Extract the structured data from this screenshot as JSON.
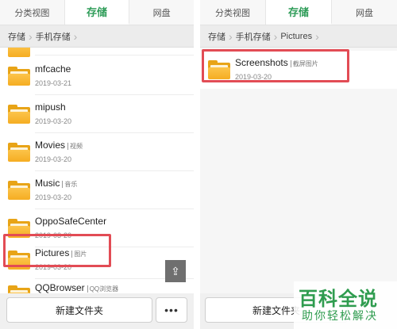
{
  "tabs": {
    "categories": "分类视图",
    "storage": "存储",
    "cloud": "网盘"
  },
  "left": {
    "breadcrumb": [
      "存储",
      "手机存储"
    ],
    "partial_date": "2019-03-21",
    "items": [
      {
        "name": "mfcache",
        "tag": "",
        "date": "2019-03-21"
      },
      {
        "name": "mipush",
        "tag": "",
        "date": "2019-03-20"
      },
      {
        "name": "Movies",
        "tag": "视频",
        "date": "2019-03-20"
      },
      {
        "name": "Music",
        "tag": "音乐",
        "date": "2019-03-20"
      },
      {
        "name": "OppoSafeCenter",
        "tag": "",
        "date": "2019-03-20"
      },
      {
        "name": "Pictures",
        "tag": "图片",
        "date": "2019-03-20"
      },
      {
        "name": "QQBrowser",
        "tag": "QQ浏览器",
        "date": ""
      }
    ],
    "scroll_top_icon": "scroll-top-icon",
    "new_folder_label": "新建文件夹",
    "more_label": "•••"
  },
  "right": {
    "breadcrumb": [
      "存储",
      "手机存储",
      "Pictures"
    ],
    "items": [
      {
        "name": "Screenshots",
        "tag": "截屏图片",
        "date": "2019-03-20"
      }
    ],
    "new_folder_label": "新建文件夹"
  },
  "watermark": {
    "title": "百科全说",
    "subtitle": "助你轻松解决"
  },
  "colors": {
    "accent": "#2e9c58",
    "highlight": "#e24c55",
    "folder": "#f5ad22"
  }
}
